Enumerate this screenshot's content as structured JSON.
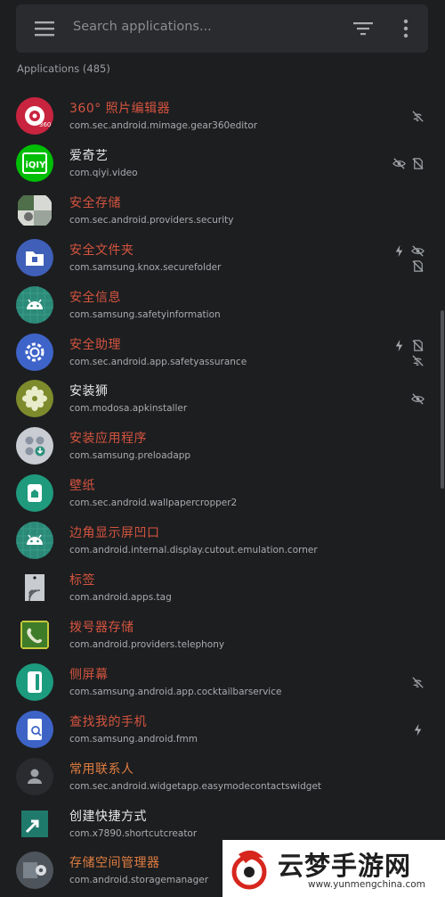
{
  "search": {
    "placeholder": "Search applications..."
  },
  "section_label": "Applications (485)",
  "apps": [
    {
      "name": "360° 照片编辑器",
      "pkg": "com.sec.android.mimage.gear360editor",
      "name_color": "red",
      "icon": "gear360-icon",
      "flags": [
        "no-internet-icon"
      ]
    },
    {
      "name": "爱奇艺",
      "pkg": "com.qiyi.video",
      "name_color": "white",
      "icon": "iqiyi-icon",
      "flags": [
        "hidden-icon",
        "no-sdcard-icon"
      ]
    },
    {
      "name": "安全存储",
      "pkg": "com.sec.android.providers.security",
      "name_color": "red",
      "icon": "security-storage-icon",
      "flags": []
    },
    {
      "name": "安全文件夹",
      "pkg": "com.samsung.knox.securefolder",
      "name_color": "red",
      "icon": "secure-folder-icon",
      "flags": [
        "bolt-icon",
        "hidden-icon",
        "no-sdcard-icon"
      ]
    },
    {
      "name": "安全信息",
      "pkg": "com.samsung.safetyinformation",
      "name_color": "red",
      "icon": "android-icon",
      "flags": []
    },
    {
      "name": "安全助理",
      "pkg": "com.sec.android.app.safetyassurance",
      "name_color": "red",
      "icon": "gear-icon",
      "flags": [
        "bolt-icon",
        "no-sdcard-icon",
        "no-internet-icon"
      ]
    },
    {
      "name": "安装狮",
      "pkg": "com.modosa.apkinstaller",
      "name_color": "white",
      "icon": "flower-icon",
      "flags": [
        "hidden-icon"
      ]
    },
    {
      "name": "安装应用程序",
      "pkg": "com.samsung.preloadapp",
      "name_color": "red",
      "icon": "preload-icon",
      "flags": []
    },
    {
      "name": "壁纸",
      "pkg": "com.sec.android.wallpapercropper2",
      "name_color": "red",
      "icon": "wallpaper-icon",
      "flags": []
    },
    {
      "name": "边角显示屏凹口",
      "pkg": "com.android.internal.display.cutout.emulation.corner",
      "name_color": "red",
      "icon": "android-icon",
      "flags": []
    },
    {
      "name": "标签",
      "pkg": "com.android.apps.tag",
      "name_color": "red",
      "icon": "nfc-tag-icon",
      "flags": []
    },
    {
      "name": "拨号器存储",
      "pkg": "com.android.providers.telephony",
      "name_color": "red",
      "icon": "phone-icon",
      "flags": []
    },
    {
      "name": "侧屏幕",
      "pkg": "com.samsung.android.app.cocktailbarservice",
      "name_color": "red",
      "icon": "edge-screen-icon",
      "flags": [
        "no-internet-icon"
      ]
    },
    {
      "name": "查找我的手机",
      "pkg": "com.samsung.android.fmm",
      "name_color": "red",
      "icon": "find-phone-icon",
      "flags": [
        "bolt-icon"
      ]
    },
    {
      "name": "常用联系人",
      "pkg": "com.sec.android.widgetapp.easymodecontactswidget",
      "name_color": "orange",
      "icon": "contact-icon",
      "flags": []
    },
    {
      "name": "创建快捷方式",
      "pkg": "com.x7890.shortcutcreator",
      "name_color": "white",
      "icon": "shortcut-icon",
      "flags": []
    },
    {
      "name": "存储空间管理器",
      "pkg": "com.android.storagemanager",
      "name_color": "orange",
      "icon": "storage-manager-icon",
      "flags": []
    }
  ],
  "watermark": {
    "text": "云梦手游网",
    "url": "www.yunmengchina.com"
  }
}
